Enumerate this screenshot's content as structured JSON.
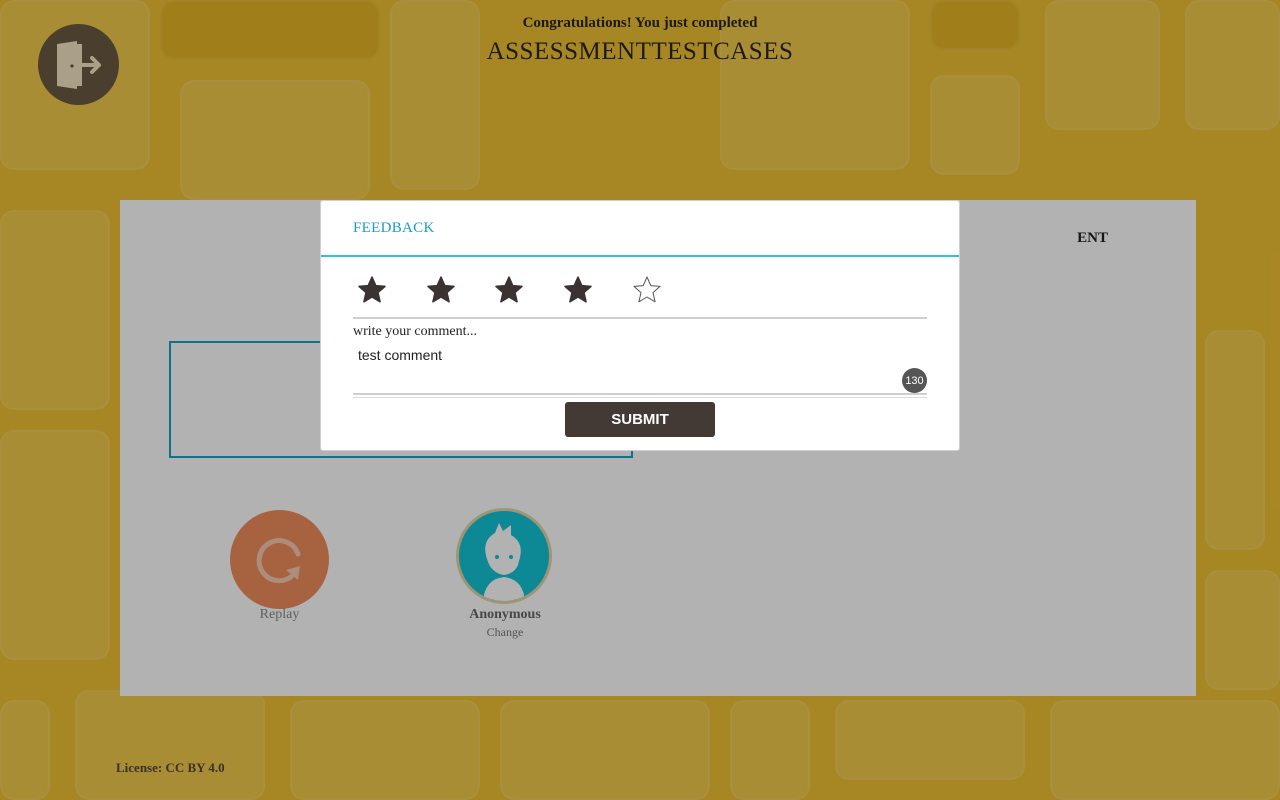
{
  "header": {
    "congrats_text": "Congratulations! You just completed",
    "test_name": "ASSESSMENTTESTCASES"
  },
  "footer": {
    "license": "License: CC BY 4.0"
  },
  "results": {
    "partial_heading": "ENT",
    "replay_label": "Replay",
    "username": "Anonymous",
    "change_label": "Change"
  },
  "feedback_modal": {
    "title": "FEEDBACK",
    "rating": 4,
    "rating_max": 5,
    "comment_label": "write your comment...",
    "comment_value": "test comment",
    "remaining_chars": "130",
    "submit_label": "SUBMIT"
  },
  "colors": {
    "accent": "#1a9cc7",
    "submit_bg": "#433a36",
    "replay": "#f08d5c",
    "avatar_bg": "#14c3d6",
    "background": "#f0c234"
  },
  "icons": {
    "exit": "exit-door-icon",
    "replay": "replay-icon",
    "avatar": "user-avatar-icon",
    "star_filled": "star-filled-icon",
    "star_empty": "star-outline-icon"
  }
}
